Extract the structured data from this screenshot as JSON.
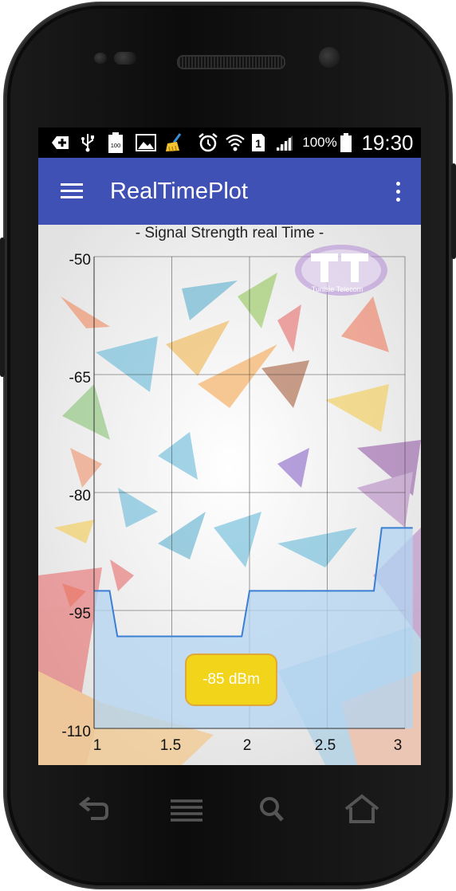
{
  "status_bar": {
    "battery_small": "100",
    "sim_slot": "1",
    "battery_percent": "100%",
    "time": "19:30",
    "icons": [
      "add-notification-icon",
      "usb-icon",
      "battery-100-icon",
      "image-icon",
      "cleaner-icon",
      "alarm-icon",
      "wifi-icon",
      "sim-1-icon",
      "signal-icon",
      "battery-icon"
    ]
  },
  "app_bar": {
    "title": "RealTimePlot",
    "menu_icon": "hamburger-menu-icon",
    "overflow_icon": "more-vert-icon",
    "color": "#3f51b5"
  },
  "chart_data": {
    "type": "area",
    "title": "- Signal Strength real Time -",
    "xlim": [
      1,
      3
    ],
    "ylim": [
      -110,
      -50
    ],
    "x_ticks": [
      "1",
      "1.5",
      "2",
      "2.5",
      "3"
    ],
    "y_ticks": [
      "-50",
      "-65",
      "-80",
      "-95",
      "-110"
    ],
    "grid": true,
    "series": [
      {
        "x": [
          1.0,
          1.1,
          1.15,
          1.95,
          2.0,
          2.8,
          2.85,
          3.05
        ],
        "y": [
          -92.5,
          -92.5,
          -98.3,
          -98.3,
          -92.5,
          -92.5,
          -84.5,
          -84.5
        ],
        "line_color": "#3b7fd4",
        "fill_color": "#b3d4f2"
      }
    ]
  },
  "overlay": {
    "current_value": "-85 dBm",
    "badge_color": "#f2d51a",
    "logo_text": "Tunisie Telecom"
  },
  "nav_bar": {
    "icons": [
      "back-icon",
      "menu-icon",
      "search-icon",
      "home-icon"
    ]
  }
}
